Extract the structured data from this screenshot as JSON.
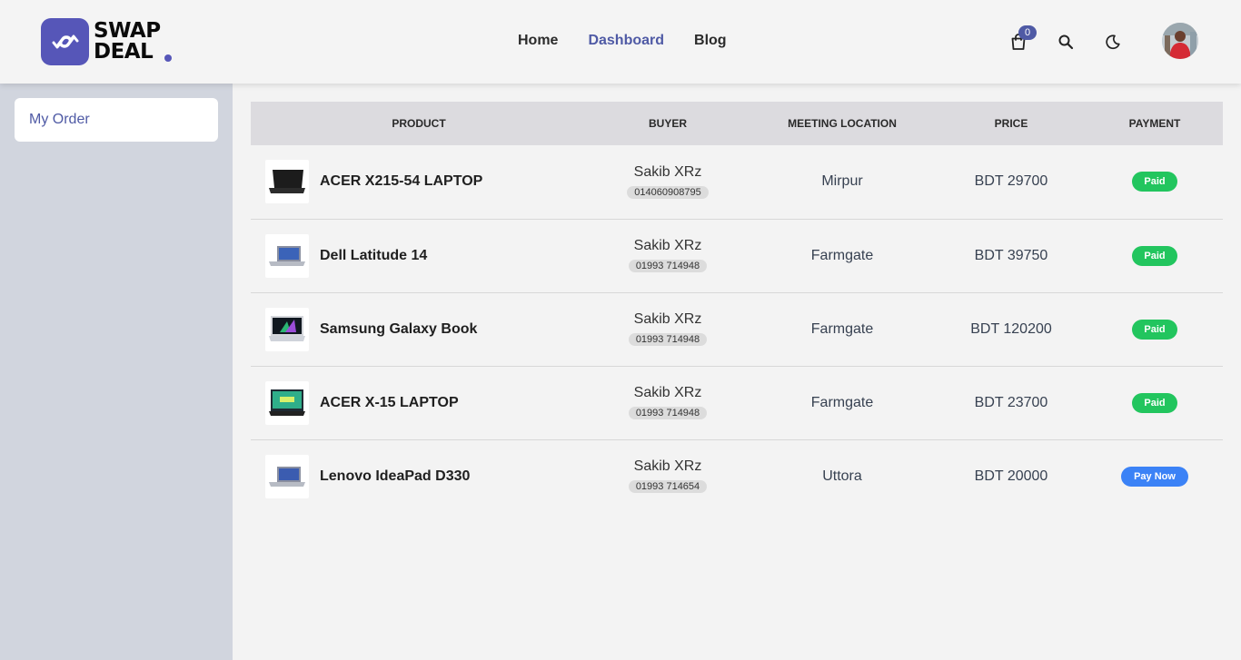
{
  "brand": {
    "line1": "SWAP",
    "line2": "DEAL"
  },
  "nav": {
    "home": "Home",
    "dashboard": "Dashboard",
    "blog": "Blog"
  },
  "cart": {
    "count": "0",
    "icon": "shopping-bag-icon"
  },
  "icons": {
    "search": "search-icon",
    "theme": "moon-icon"
  },
  "colors": {
    "accent": "#4f5aa5",
    "paid": "#22c55e",
    "pay_now": "#3b82f6",
    "sidebar": "#d1d5de"
  },
  "sidebar": {
    "items": [
      {
        "label": "My Order"
      }
    ]
  },
  "table": {
    "headers": [
      "Product",
      "Buyer",
      "Meeting Location",
      "Price",
      "Payment"
    ],
    "rows": [
      {
        "product": "ACER X215-54 LAPTOP",
        "buyer": "Sakib XRz",
        "phone": "014060908795",
        "location": "Mirpur",
        "price": "BDT 29700",
        "payment": "Paid"
      },
      {
        "product": "Dell Latitude 14",
        "buyer": "Sakib XRz",
        "phone": "01993 714948",
        "location": "Farmgate",
        "price": "BDT 39750",
        "payment": "Paid"
      },
      {
        "product": "Samsung Galaxy Book",
        "buyer": "Sakib XRz",
        "phone": "01993 714948",
        "location": "Farmgate",
        "price": "BDT 120200",
        "payment": "Paid"
      },
      {
        "product": "ACER X-15 LAPTOP",
        "buyer": "Sakib XRz",
        "phone": "01993 714948",
        "location": "Farmgate",
        "price": "BDT 23700",
        "payment": "Paid"
      },
      {
        "product": "Lenovo IdeaPad D330",
        "buyer": "Sakib XRz",
        "phone": "01993 714654",
        "location": "Uttora",
        "price": "BDT 20000",
        "payment": "Pay Now"
      }
    ]
  }
}
